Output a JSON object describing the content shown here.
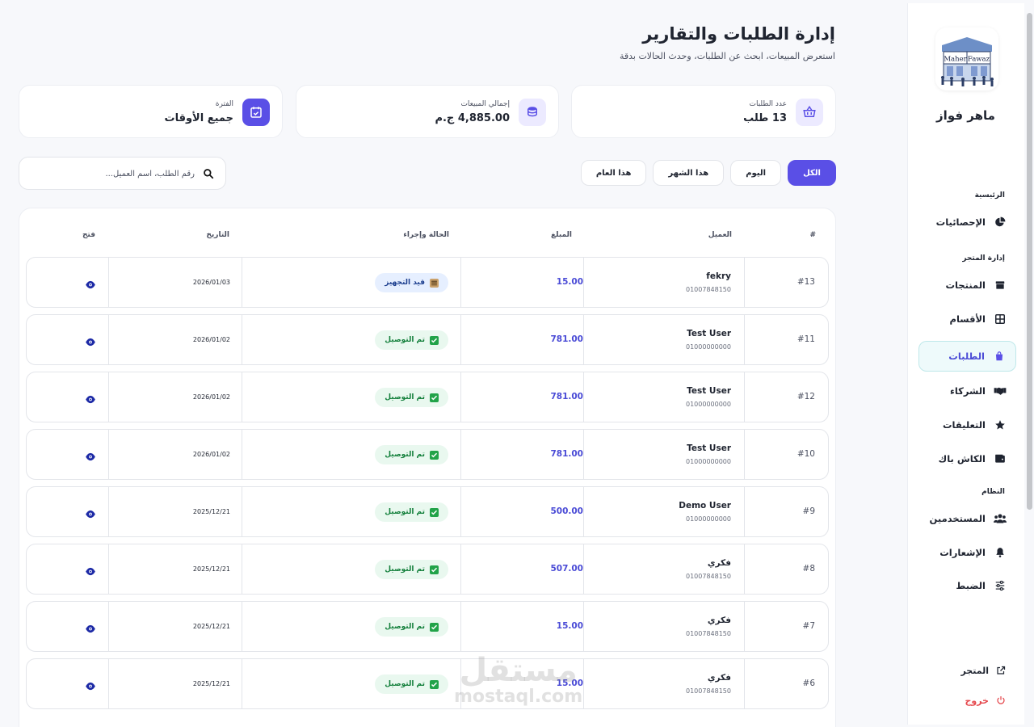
{
  "header": {
    "title": "إدارة الطلبات والتقارير",
    "subtitle": "استعرض المبيعات، ابحث عن الطلبات، وحدث الحالات بدقة"
  },
  "stats": [
    {
      "label": "عدد الطلبات",
      "value": "13 طلب",
      "icon": "basket-icon"
    },
    {
      "label": "إجمالي المبيعات",
      "value": "4,885.00 ج.م",
      "icon": "coins-icon"
    },
    {
      "label": "الفترة",
      "value": "جميع الأوقات",
      "icon": "calendar-icon"
    }
  ],
  "filters": {
    "all": "الكل",
    "today": "اليوم",
    "month": "هذا الشهر",
    "year": "هذا العام",
    "active": "all"
  },
  "search": {
    "placeholder": "رقم الطلب، اسم العميل..."
  },
  "table": {
    "headers": {
      "num": "#",
      "customer": "العميل",
      "amount": "المبلغ",
      "status": "الحالة وإجراء",
      "date": "التاريخ",
      "open": "فتح"
    },
    "rows": [
      {
        "num": "#13",
        "name": "fekry",
        "phone": "01007848150",
        "amount": "15.00",
        "status": "قيد التجهيز",
        "status_type": "preparing",
        "date": "2026/01/03"
      },
      {
        "num": "#11",
        "name": "Test User",
        "phone": "01000000000",
        "amount": "781.00",
        "status": "تم التوصيل",
        "status_type": "delivered",
        "date": "2026/01/02"
      },
      {
        "num": "#12",
        "name": "Test User",
        "phone": "01000000000",
        "amount": "781.00",
        "status": "تم التوصيل",
        "status_type": "delivered",
        "date": "2026/01/02"
      },
      {
        "num": "#10",
        "name": "Test User",
        "phone": "01000000000",
        "amount": "781.00",
        "status": "تم التوصيل",
        "status_type": "delivered",
        "date": "2026/01/02"
      },
      {
        "num": "#9",
        "name": "Demo User",
        "phone": "01000000000",
        "amount": "500.00",
        "status": "تم التوصيل",
        "status_type": "delivered",
        "date": "2025/12/21"
      },
      {
        "num": "#8",
        "name": "فكري",
        "phone": "01007848150",
        "amount": "507.00",
        "status": "تم التوصيل",
        "status_type": "delivered",
        "date": "2025/12/21"
      },
      {
        "num": "#7",
        "name": "فكري",
        "phone": "01007848150",
        "amount": "15.00",
        "status": "تم التوصيل",
        "status_type": "delivered",
        "date": "2025/12/21"
      },
      {
        "num": "#6",
        "name": "فكري",
        "phone": "01007848150",
        "amount": "15.00",
        "status": "تم التوصيل",
        "status_type": "delivered",
        "date": "2025/12/21"
      }
    ]
  },
  "sidebar": {
    "logo_text": [
      "Maher",
      "Fawaz"
    ],
    "brand": "ماهر فواز",
    "section_main": "الرئيسية",
    "section_store": "إدارة المتجر",
    "section_system": "النظام",
    "items": [
      {
        "label": "الإحصائيات",
        "icon": "pie-chart-icon"
      },
      {
        "label": "المنتجات",
        "icon": "box-icon"
      },
      {
        "label": "الأقسام",
        "icon": "grid-icon"
      },
      {
        "label": "الطلبات",
        "icon": "shopping-bag-icon"
      },
      {
        "label": "الشركاء",
        "icon": "handshake-icon"
      },
      {
        "label": "التعليقات",
        "icon": "star-icon"
      },
      {
        "label": "الكاش باك",
        "icon": "wallet-icon"
      },
      {
        "label": "المستخدمين",
        "icon": "users-icon"
      },
      {
        "label": "الإشعارات",
        "icon": "bell-icon"
      },
      {
        "label": "الضبط",
        "icon": "sliders-icon"
      }
    ],
    "store_link": "المتجر",
    "logout": "خروج"
  },
  "watermark": {
    "arabic": "مستقل",
    "latin": "mostaql.com"
  },
  "colors": {
    "accent": "#5a4fe6",
    "amount": "#4a4bd6",
    "danger": "#e5484d",
    "success": "#14803c"
  }
}
